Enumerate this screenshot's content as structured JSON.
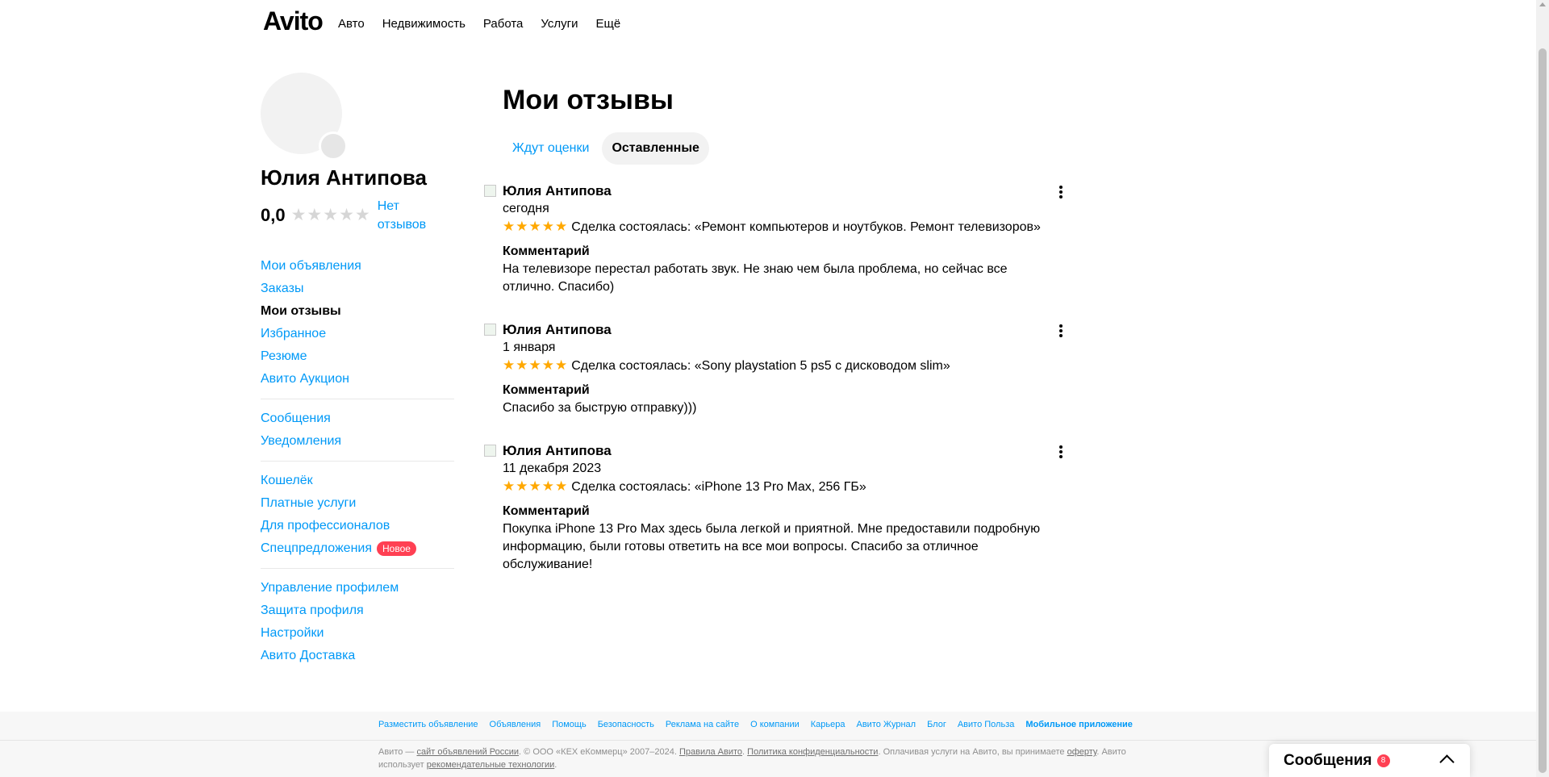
{
  "header": {
    "logo": "Avito",
    "nav": [
      "Авто",
      "Недвижимость",
      "Работа",
      "Услуги",
      "Ещё"
    ]
  },
  "profile": {
    "name": "Юлия Антипова",
    "rating": "0,0",
    "rating_stars": "★★★★★",
    "rating_value_num": 0,
    "no_reviews": "Нет отзывов"
  },
  "sidebar": {
    "group1": [
      "Мои объявления",
      "Заказы",
      "Мои отзывы",
      "Избранное",
      "Резюме",
      "Авито Аукцион"
    ],
    "group2": [
      "Сообщения",
      "Уведомления"
    ],
    "group3": [
      "Кошелёк",
      "Платные услуги",
      "Для профессионалов",
      "Спецпредложения"
    ],
    "new_badge": "Новое",
    "group4": [
      "Управление профилем",
      "Защита профиля",
      "Настройки",
      "Авито Доставка"
    ],
    "active_item": "Мои отзывы"
  },
  "main": {
    "title": "Мои отзывы",
    "tabs": [
      "Ждут оценки",
      "Оставленные"
    ],
    "active_tab": "Оставленные",
    "reviews": [
      {
        "author": "Юлия Антипова",
        "date": "сегодня",
        "stars": "★★★★★",
        "rating": 5,
        "deal": "Сделка состоялась: «Ремонт компьютеров и ноутбуков. Ремонт телевизоров»",
        "comment_label": "Комментарий",
        "comment": "На телевизоре перестал работать звук. Не знаю чем была проблема, но сейчас все отлично. Спасибо)"
      },
      {
        "author": "Юлия Антипова",
        "date": "1 января",
        "stars": "★★★★★",
        "rating": 5,
        "deal": "Сделка состоялась: «Sony playstation 5 ps5 с дисководом slim»",
        "comment_label": "Комментарий",
        "comment": "Спасибо за быструю отправку)))"
      },
      {
        "author": "Юлия Антипова",
        "date": "11 декабря 2023",
        "stars": "★★★★★",
        "rating": 5,
        "deal": "Сделка состоялась: «iPhone 13 Pro Max, 256 ГБ»",
        "comment_label": "Комментарий",
        "comment": "Покупка iPhone 13 Pro Max здесь была легкой и приятной. Мне предоставили подробную информацию, были готовы ответить на все мои вопросы. Спасибо за отличное обслуживание!"
      }
    ]
  },
  "footer": {
    "links": [
      "Разместить объявление",
      "Объявления",
      "Помощь",
      "Безопасность",
      "Реклама на сайте",
      "О компании",
      "Карьера",
      "Авито Журнал",
      "Блог",
      "Авито Польза",
      "Мобильное приложение"
    ],
    "legal": {
      "p1": "Авито — ",
      "link1": "сайт объявлений России",
      "p2": ". © ООО «КЕХ еКоммерц» 2007–2024. ",
      "link2": "Правила Авито",
      "p3": ". ",
      "link3": "Политика конфиденциальности",
      "p4": ". Оплачивая услуги на Авито, вы принимаете ",
      "link4": "оферту",
      "p5": ". Авито использует ",
      "link5": "рекомендательные технологии",
      "p6": "."
    }
  },
  "messenger": {
    "title": "Сообщения",
    "count": "8"
  },
  "colors": {
    "link": "#0099f7",
    "star": "#ffa800",
    "badge": "#ff4053"
  },
  "icons": [
    "avatar-placeholder",
    "star-icon",
    "more-vertical-icon",
    "review-image-icon",
    "chevron-up-icon"
  ]
}
